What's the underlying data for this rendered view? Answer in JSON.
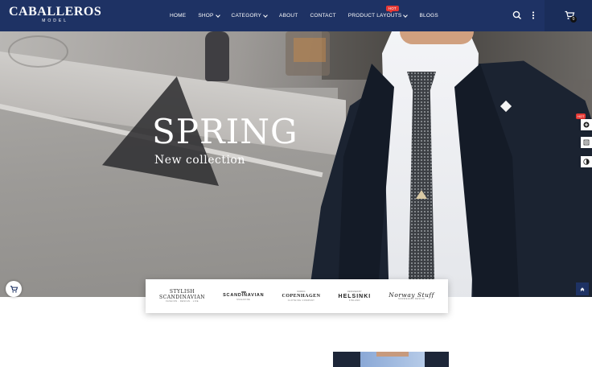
{
  "header": {
    "logo_main": "CABALLEROS",
    "logo_sub": "MODEL",
    "nav": [
      {
        "label": "HOME",
        "has_dropdown": false
      },
      {
        "label": "SHOP",
        "has_dropdown": true
      },
      {
        "label": "CATEGORY",
        "has_dropdown": true
      },
      {
        "label": "ABOUT",
        "has_dropdown": false
      },
      {
        "label": "CONTACT",
        "has_dropdown": false
      },
      {
        "label": "PRODUCT LAYOUTS",
        "has_dropdown": true,
        "badge": "HOT"
      },
      {
        "label": "BLOGS",
        "has_dropdown": false
      }
    ],
    "cart_count": "0",
    "icons": [
      "search-icon",
      "more-vertical-icon",
      "cart-icon"
    ]
  },
  "hero": {
    "title": "SPRING",
    "subtitle": "New collection"
  },
  "sidebar_tools": {
    "hot_badge": "HOT",
    "icons": [
      "plus-circle-icon",
      "sliders-icon",
      "contrast-icon"
    ]
  },
  "brands": [
    {
      "top": "",
      "name": "STYLISH",
      "name2": "SCANDINAVIAN",
      "sub": "FASHION · DESIGN · LIFE"
    },
    {
      "top": "",
      "name": "SCANDINAVIAN",
      "name2": "",
      "sub": "MAGAZINE"
    },
    {
      "top": "NORDIC",
      "name": "COPENHAGEN",
      "name2": "",
      "sub": "CLOTHING COMPANY"
    },
    {
      "top": "DESIGNED BY",
      "name": "HELSINKI",
      "name2": "",
      "sub": "FINLAND"
    },
    {
      "top": "",
      "name": "Norway Stuff",
      "name2": "",
      "sub": "NORWEGIAN DESIGN"
    }
  ],
  "colors": {
    "header_bg": "#1e3264",
    "hot_badge": "#e53935",
    "overlay": "#303032"
  }
}
